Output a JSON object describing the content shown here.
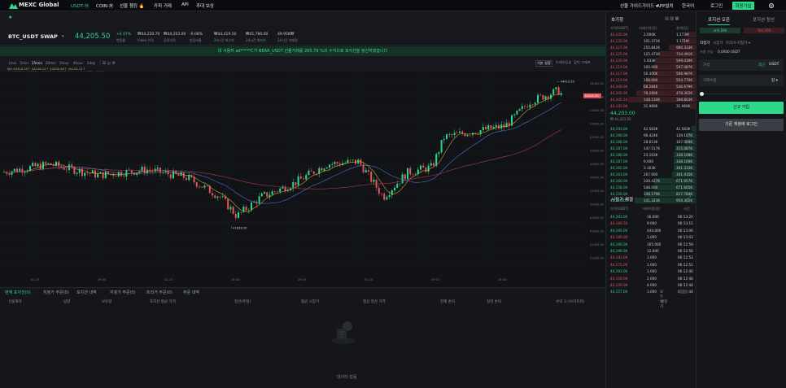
{
  "nav": {
    "logo": "MEXC Global",
    "usdt": "USDT-Ⓜ",
    "coin": "COIN-Ⓜ",
    "event": "선물 챔킹 🔥",
    "copy": "카피 거래",
    "api": "API",
    "rebate": "추대 보상",
    "guide": "선물 가이드가이드 ▾",
    "app": "APP설치",
    "lang": "한국어",
    "login": "로그인",
    "signup": "회원가입"
  },
  "ticker": {
    "symbol": "BTC_USDT SWAP",
    "price": "44,205.50",
    "change_pct": "+4.07%",
    "change_label": "변동률",
    "index_price": "₩44,220.70",
    "index_label": "Index 가격",
    "fair_price": "₩44,203.00",
    "fair_label": "공정가격",
    "funding": "-0.08%",
    "funding_label": "펀딩비율",
    "high": "₩44,419.50",
    "high_label": "24시간 최고가",
    "low": "₩41,780.00",
    "low_label": "24시간 최저가",
    "vol": "49.95K₩",
    "vol_label": "24시간 거래량"
  },
  "notice": "대 사용자 ad*****C가 NEAR_USDT 선물거래를 265.79 %의 수익으로 포지션을 정산하였습니다",
  "charttools": {
    "intervals": [
      "1min",
      "5min",
      "15min",
      "30min",
      "1hour",
      "4hour",
      "1day"
    ],
    "active": "15min",
    "ohlc": "O: 44237  H: 44283  L: 44197  C: 44208  Volume: 14.0832  -0.08%",
    "ma": "MA  44204.25↑  44248.12↑  44200.62↑  44124.11↑",
    "views": [
      "기본 설정",
      "트레이딩뷰",
      "깊이 그래프"
    ]
  },
  "chart_data": {
    "type": "candlestick",
    "x_ticks": [
      "02-13",
      "19:45",
      "02-14",
      "16:45",
      "19:15",
      "02-15",
      "09:15",
      "16:45"
    ],
    "y_ticks": [
      "44400.00",
      "44200.00",
      "43800.00",
      "43600.00",
      "43200.00",
      "43000.00",
      "42800.00",
      "42600.00",
      "42400.00",
      "42200.00",
      "41800.00",
      "41600.00",
      "41400.00",
      "41200.00"
    ],
    "ylim": [
      41100,
      44500
    ],
    "high_label": "44419.50",
    "low_label": "41838.00",
    "last_label": "44205.50"
  },
  "orderbook": {
    "title": "호가창",
    "cols": [
      "가격(USDT)",
      "거래수량(장)",
      "총액(장)"
    ],
    "asks": [
      [
        "44,242.00",
        "2.000K",
        "1.173M"
      ],
      [
        "44,235.00",
        "101.371K",
        "1.171M"
      ],
      [
        "44,227.00",
        "255.842K",
        "990.333K"
      ],
      [
        "44,225.00",
        "125.473K",
        "734.491K"
      ],
      [
        "44,220.00",
        "1.933K",
        "599.039K"
      ],
      [
        "44,219.00",
        "100.000",
        "597.087K"
      ],
      [
        "44,217.00",
        "50.300K",
        "596.987K"
      ],
      [
        "44,210.00",
        "108.000",
        "554.779K"
      ],
      [
        "44,208.00",
        "68.284K",
        "546.679K"
      ],
      [
        "44,206.00",
        "78.260K",
        "478.362K"
      ],
      [
        "44,205.50",
        "148.134K",
        "398.803K"
      ],
      [
        "44,193.00",
        "31.969K",
        "31.969K"
      ]
    ],
    "mid_price": "44,203.00",
    "mid_sub": "₩ 44,203.00",
    "bids": [
      [
        "44,193.00",
        "42.583K",
        "42.583K"
      ],
      [
        "44,190.00",
        "96.424K",
        "139.107K"
      ],
      [
        "44,188.00",
        "28.613K",
        "167.569K"
      ],
      [
        "44,187.00",
        "147.517K",
        "315.087K"
      ],
      [
        "44,186.00",
        "23.103K",
        "338.168K"
      ],
      [
        "44,187.00",
        "9.000",
        "338.169K"
      ],
      [
        "44,165.00",
        "3.163K",
        "341.333K"
      ],
      [
        "44,163.00",
        "207.000",
        "341.435K"
      ],
      [
        "44,160.00",
        "330.427K",
        "671.957K"
      ],
      [
        "44,158.00",
        "548.000",
        "671.605K"
      ],
      [
        "44,156.00",
        "146.179K",
        "817.784K"
      ],
      [
        "44,114.00",
        "141.323K",
        "959.302K"
      ]
    ],
    "trades_title": "시장가 체결",
    "trade_cols": [
      "가격(USDT)",
      "거래수량(장)",
      "시간"
    ],
    "trades": [
      [
        "44,203.00",
        "16.000",
        "06:13:20"
      ],
      [
        "44,189.50",
        "9.000",
        "06:13:15"
      ],
      [
        "44,195.00",
        "444.000",
        "06:13:06"
      ],
      [
        "44,189.00",
        "1.000",
        "06:13:03"
      ],
      [
        "44,190.00",
        "165.000",
        "06:12:59"
      ],
      [
        "44,199.00",
        "12.000",
        "06:12:56"
      ],
      [
        "44,193.00",
        "1.000",
        "06:12:53"
      ],
      [
        "44,175.00",
        "1.000",
        "06:12:51"
      ],
      [
        "44,193.00",
        "1.000",
        "06:12:46"
      ],
      [
        "44,158.00",
        "2.000",
        "06:12:46"
      ],
      [
        "44,156.00",
        "4.000",
        "06:12:44"
      ],
      [
        "44,157.00",
        "1.000",
        "06:12:44"
      ]
    ]
  },
  "panel": {
    "tab_open": "포지션 오픈",
    "tab_close": "포지션 청산",
    "mode1": "교차 20X",
    "mode2": "격리 20X",
    "order_types": [
      "지정가",
      "시장가",
      "트리거·지정가 ▾"
    ],
    "available_label": "사용 가능",
    "available_value": "0.0000 USDT",
    "price_ph": "가격",
    "price_tag": "최근",
    "price_unit": "USDT",
    "qty_ph": "거래수량",
    "qty_unit": "장 ▾",
    "buy_btn": "신규 가입",
    "login_btn": "기존 계정에 로그인"
  },
  "bottom": {
    "tabs": [
      "현재 포지션(0)",
      "지정가 주문(0)",
      "포지션 내역",
      "지정가 주문(0)",
      "트리거 주문(0)",
      "주문 내역"
    ],
    "toggle": "모두 보기",
    "cols": [
      "선물계약",
      "방향",
      "보유량",
      "포지션 평균 가격",
      "청산(추정)",
      "평균 시장가",
      "평상 청산 가격",
      "현재 손익",
      "실현 손익",
      "수익 ① (브이트리)",
      "설정"
    ],
    "empty": "데이터 없음"
  }
}
